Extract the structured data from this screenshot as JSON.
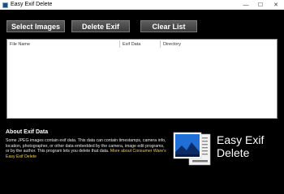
{
  "window": {
    "title": "Easy Exif Delete",
    "controls": {
      "minimize": "—",
      "maximize": "☐",
      "close": "✕"
    }
  },
  "toolbar": {
    "select_images": "Select Images",
    "delete_exif": "Delete Exif",
    "clear_list": "Clear List"
  },
  "file_list": {
    "columns": [
      "File Name",
      "Exif Data",
      "Directory"
    ],
    "rows": []
  },
  "about": {
    "title": "About Exif Data",
    "text": "Some JPEG images contain exif data. This data can contain timestamps, camera info, location, photographer, or other data embedded by the camera, image edit programs, or by the author. This program lets you delete that data.",
    "link": "More about Consumer Ware's Easy Exif Delete"
  },
  "branding": {
    "line1": "Easy Exif",
    "line2": "Delete",
    "logo_icon": "photo-with-exif-sheet-icon"
  },
  "colors": {
    "background": "#000000",
    "button": "#4a4a4a",
    "link": "#e7d34c",
    "logo_sky": "#1f6fd6"
  }
}
